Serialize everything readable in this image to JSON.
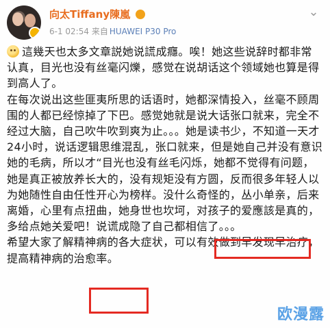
{
  "header": {
    "username": "向太Tiffany陳嵐",
    "time": "6-1 02:54",
    "source_prefix": "来自",
    "device": "HUAWEI P30 Pro"
  },
  "post": {
    "paragraphs": [
      "這幾天也太多文章説她说謊成癮。唉！她这些说辞时都非常认真，目光也没有丝毫闪爍，感觉在说胡话这个领域她也算是得到高人了。",
      "在每次说出这些匪夷所思的话语时，她都深情投入，丝毫不顾周围的人都已经惊掉了下巴。感觉她就是说大话张口就来，完全不经过大脑，自己吹牛吹到爽为止。。。她是读书少，不知道一天才24小时，说话逻辑思维混乱，张口就来，但是她自己并没有意识她的毛病，所以才“目光也没有丝毛闪烁，她都不觉得有问题，她是真正被放养长大的，没有规矩没有方圆，反而很多年轻人以为她随性自由任性开心为榜样。没什么奇怪的，丛小单亲，后来离婚，心里有点扭曲，她身世也坎坷，对孩子的爱應該是真的，多给点她关爱吧！说谎成隐了自己都相信了。。。",
      "希望大家了解精神病的各大症状，可以有效做到早发现早治疗，提高精神病的治愈率。"
    ]
  },
  "watermark": "欧漫露"
}
